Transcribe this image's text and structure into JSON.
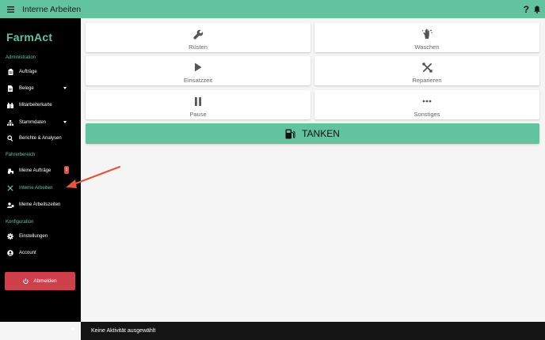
{
  "header": {
    "title": "Interne Arbeiten",
    "help": "?"
  },
  "sidebar": {
    "brand": "FarmAct",
    "sections": {
      "administration": "Administration",
      "fahrerbereich": "Fahrerbereich",
      "konfiguration": "Konfiguration"
    },
    "items": [
      {
        "label": "Aufträge",
        "icon": "clipboard-icon"
      },
      {
        "label": "Belege",
        "icon": "document-icon"
      },
      {
        "label": "Mitarbeiterkarte",
        "icon": "map-icon"
      },
      {
        "label": "Stammdaten",
        "icon": "hierarchy-icon"
      },
      {
        "label": "Berichte & Analysen",
        "icon": "search-icon"
      },
      {
        "label": "Meine Aufträge",
        "icon": "tractor-icon",
        "badge": "1"
      },
      {
        "label": "Interne Arbeiten",
        "icon": "tools-icon",
        "active": true
      },
      {
        "label": "Meine Arbeitszeiten",
        "icon": "user-clock-icon"
      },
      {
        "label": "Einstellungen",
        "icon": "gear-icon"
      },
      {
        "label": "Account",
        "icon": "account-icon"
      }
    ],
    "logout": "Abmelden"
  },
  "tiles": [
    {
      "label": "Rüsten",
      "icon": "wrench-icon"
    },
    {
      "label": "Waschen",
      "icon": "wash-hand-icon"
    },
    {
      "label": "Einsatzzeit",
      "icon": "play-icon"
    },
    {
      "label": "Reparieren",
      "icon": "tools-icon"
    },
    {
      "label": "Pause",
      "icon": "pause-icon"
    },
    {
      "label": "Sonstiges",
      "icon": "more-icon"
    }
  ],
  "tanken": {
    "label": "TANKEN",
    "icon": "fuel-icon"
  },
  "status": {
    "text": "Keine Aktivität ausgewählt"
  },
  "colors": {
    "accent": "#62c3a1",
    "danger": "#d0404c",
    "sidebar": "#000000",
    "annotation": "#e8553a"
  }
}
